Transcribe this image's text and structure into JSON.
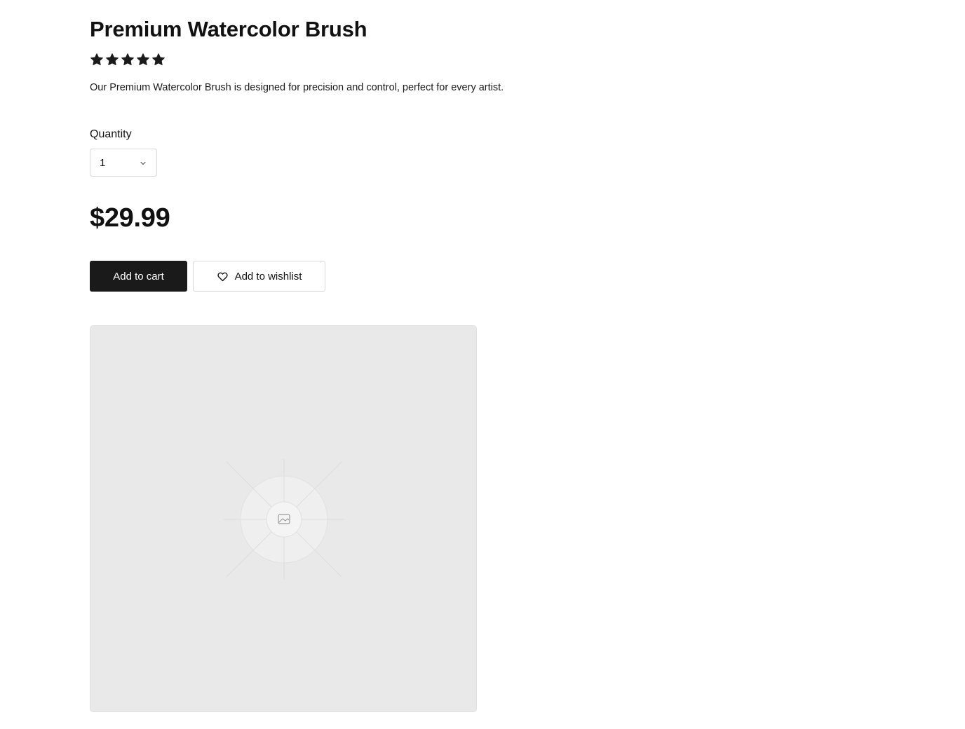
{
  "product": {
    "title": "Premium Watercolor Brush",
    "rating": 5,
    "rating_max": 5,
    "description": "Our Premium Watercolor Brush is designed for precision and control, perfect for every artist.",
    "price": "$29.99"
  },
  "quantity": {
    "label": "Quantity",
    "selected": "1"
  },
  "actions": {
    "add_to_cart_label": "Add to cart",
    "add_to_wishlist_label": "Add to wishlist"
  },
  "icons": {
    "rating": "star-icon",
    "select": "chevron-down-icon",
    "wishlist": "heart-icon",
    "placeholder": "image-icon"
  },
  "colors": {
    "primary_button": "#1a1a1a",
    "primary_button_text": "#ffffff",
    "placeholder_bg": "#e9e9e9"
  }
}
